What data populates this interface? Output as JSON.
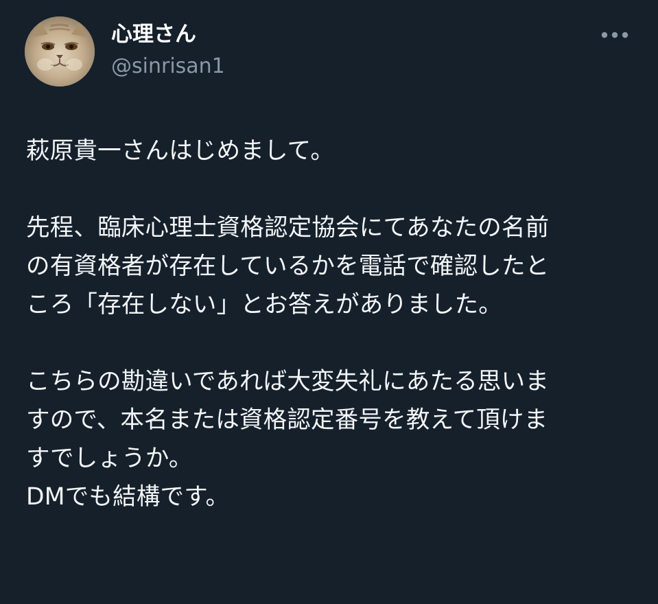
{
  "theme": {
    "background": "#15202b",
    "text_color": "#f3f5f7",
    "secondary_text_color": "#8b98a5"
  },
  "author": {
    "display_name": "心理さん",
    "handle": "@sinrisan1",
    "avatar_icon": "cat-avatar"
  },
  "more_icon": "ellipsis-icon",
  "tweet": {
    "paragraphs": [
      [
        "萩原貴一さんはじめまして。"
      ],
      [
        "先程、臨床心理士資格認定協会にてあなたの名前",
        "の有資格者が存在しているかを電話で確認したと",
        "ころ「存在しない」とお答えがありました。"
      ],
      [
        "こちらの勘違いであれば大変失礼にあたる思いま",
        "すので、本名または資格認定番号を教えて頂けま",
        "すでしょうか。",
        "DMでも結構です。"
      ]
    ]
  }
}
